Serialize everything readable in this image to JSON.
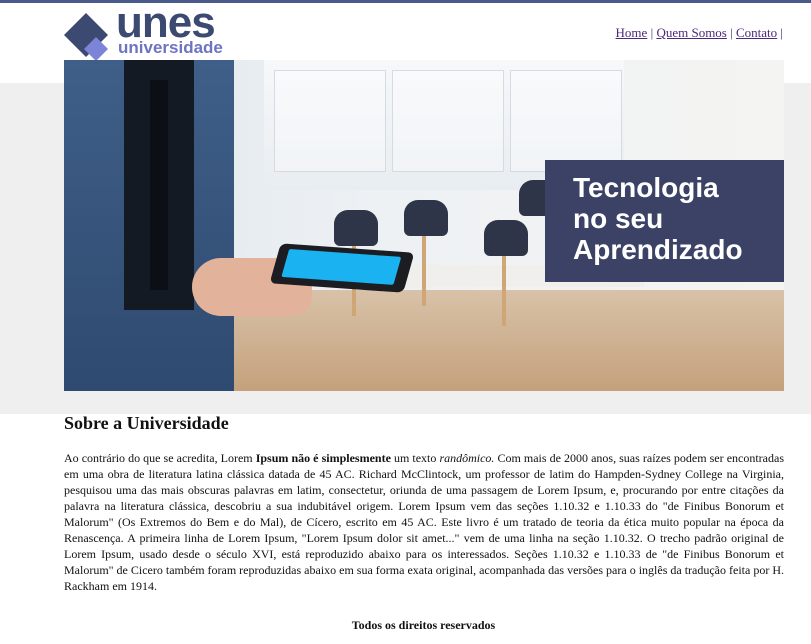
{
  "logo": {
    "line1": "unes",
    "line2": "universidade"
  },
  "nav": {
    "items": [
      "Home",
      "Quem Somos",
      "Contato"
    ],
    "separator": "|"
  },
  "banner": {
    "caption_lines": [
      "Tecnologia",
      "no seu",
      "Aprendizado"
    ]
  },
  "about": {
    "title": "Sobre a Universidade",
    "p_start": "Ao contrário do que se acredita, Lorem ",
    "p_bold": "Ipsum não é simplesmente",
    "p_mid": " um texto ",
    "p_italic": "randômico.",
    "p_rest": " Com mais de 2000 anos, suas raízes podem ser encontradas em uma obra de literatura latina clássica datada de 45 AC. Richard McClintock, um professor de latim do Hampden-Sydney College na Virginia, pesquisou uma das mais obscuras palavras em latim, consectetur, oriunda de uma passagem de Lorem Ipsum, e, procurando por entre citações da palavra na literatura clássica, descobriu a sua indubitável origem. Lorem Ipsum vem das seções 1.10.32 e 1.10.33 do \"de Finibus Bonorum et Malorum\" (Os Extremos do Bem e do Mal), de Cícero, escrito em 45 AC. Este livro é um tratado de teoria da ética muito popular na época da Renascença. A primeira linha de Lorem Ipsum, \"Lorem Ipsum dolor sit amet...\" vem de uma linha na seção 1.10.32. O trecho padrão original de Lorem Ipsum, usado desde o século XVI, está reproduzido abaixo para os interessados. Seções 1.10.32 e 1.10.33 de \"de Finibus Bonorum et Malorum\" de Cicero também foram reproduzidas abaixo em sua forma exata original, acompanhada das versões para o inglês da tradução feita por H. Rackham em 1914."
  },
  "footer": {
    "text": "Todos os direitos reservados"
  },
  "colors": {
    "brand": "#3c4a72",
    "brand_light": "#6d74c2",
    "caption_bg": "#3b4266",
    "link": "#4b2a7a"
  }
}
